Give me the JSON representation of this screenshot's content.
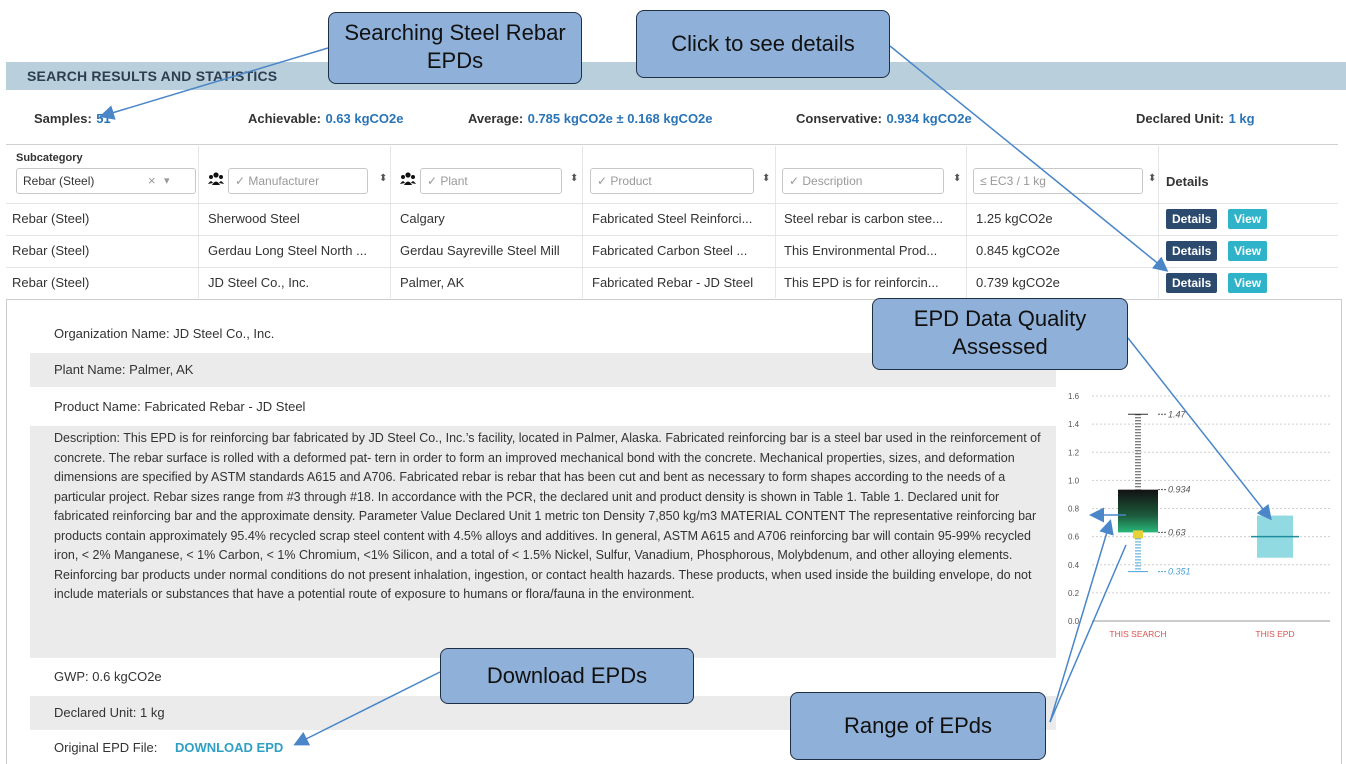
{
  "header": {
    "title": "SEARCH RESULTS AND STATISTICS"
  },
  "stats": {
    "samples_label": "Samples:",
    "samples_value": "51",
    "achievable_label": "Achievable:",
    "achievable_value": "0.63 kgCO2e",
    "average_label": "Average:",
    "average_value": "0.785 kgCO2e ± 0.168 kgCO2e",
    "conservative_label": "Conservative:",
    "conservative_value": "0.934 kgCO2e",
    "declared_label": "Declared Unit:",
    "declared_value": "1 kg"
  },
  "table": {
    "subcategory_header": "Subcategory",
    "subcategory_value": "Rebar (Steel)",
    "clear_glyph": "×",
    "caret_glyph": "▾",
    "sort_glyph": "⬍",
    "filters": {
      "manufacturer": "✓ Manufacturer",
      "plant": "✓ Plant",
      "product": "✓ Product",
      "description": "✓ Description",
      "ec3": "≤ EC3 / 1 kg"
    },
    "details_header": "Details",
    "rows": [
      {
        "subcategory": "Rebar (Steel)",
        "manufacturer": "Sherwood Steel",
        "plant": "Calgary",
        "product": "Fabricated Steel Reinforci...",
        "description": "Steel rebar is carbon stee...",
        "gwp": "1.25 kgCO2e",
        "details_btn": "Details",
        "view_btn": "View"
      },
      {
        "subcategory": "Rebar (Steel)",
        "manufacturer": "Gerdau Long Steel North ...",
        "plant": "Gerdau Sayreville Steel Mill",
        "product": "Fabricated Carbon Steel ...",
        "description": "This Environmental Prod...",
        "gwp": "0.845 kgCO2e",
        "details_btn": "Details",
        "view_btn": "View"
      },
      {
        "subcategory": "Rebar (Steel)",
        "manufacturer": "JD Steel Co., Inc.",
        "plant": "Palmer, AK",
        "product": "Fabricated Rebar - JD Steel",
        "description": "This EPD is for reinforcin...",
        "gwp": "0.739 kgCO2e",
        "details_btn": "Details",
        "view_btn": "View"
      }
    ]
  },
  "detail": {
    "organization": "Organization Name: JD Steel Co., Inc.",
    "plant": "Plant Name: Palmer, AK",
    "product": "Product Name: Fabricated Rebar - JD Steel",
    "description": "Description: This EPD is for reinforcing bar fabricated by JD Steel Co., Inc.’s facility, located in Palmer, Alaska. Fabricated reinforcing bar is a steel bar used in the reinforcement of concrete. The rebar surface is rolled with a deformed pat- tern in order to form an improved mechanical bond with the concrete. Mechanical properties, sizes, and deformation dimensions are specified by ASTM standards A615 and A706. Fabricated rebar is rebar that has been cut and bent as necessary to form shapes according to the needs of a particular project. Rebar sizes range from #3 through #18. In accordance with the PCR, the declared unit and product density is shown in Table 1. Table 1. Declared unit for fabricated reinforcing bar and the approximate density. Parameter Value Declared Unit 1 metric ton Density 7,850 kg/m3 MATERIAL CONTENT The representative reinforcing bar products contain approximately 95.4% recycled scrap steel content with 4.5% alloys and additives. In general, ASTM A615 and A706 reinforcing bar will contain 95-99% recycled iron, < 2% Manganese, < 1% Carbon, < 1% Chromium, <1% Silicon, and a total of < 1.5% Nickel, Sulfur, Vanadium, Phosphorous, Molybdenum, and other alloying elements. Reinforcing bar products under normal conditions do not present inhalation, ingestion, or contact health hazards. These products, when used inside the building envelope, do not include materials or substances that have a potential route of exposure to humans or flora/fauna in the environment.",
    "gwp": "GWP: 0.6 kgCO2e",
    "declared_unit": "Declared Unit: 1 kg",
    "original_file_label": "Original EPD File:",
    "download_link": "DOWNLOAD EPD"
  },
  "callouts": {
    "searching": "Searching Steel Rebar EPDs",
    "click_details": "Click to see details",
    "quality": "EPD Data Quality Assessed",
    "download": "Download EPDs",
    "range": "Range of EPds"
  },
  "chart_data": {
    "type": "box",
    "y_ticks": [
      "0.0",
      "0.2",
      "0.4",
      "0.6",
      "0.8",
      "1.0",
      "1.2",
      "1.4",
      "1.6"
    ],
    "ylim": [
      0,
      1.6
    ],
    "categories": [
      "THIS SEARCH",
      "THIS EPD"
    ],
    "this_search": {
      "min": 0.351,
      "achievable": 0.63,
      "conservative": 0.934,
      "max": 1.47
    },
    "this_epd": {
      "value": 0.6
    },
    "labels": [
      "1.47",
      "0.934",
      "0.63",
      "0.351"
    ]
  },
  "colors": {
    "accent": "#2a74b6",
    "details_btn": "#2c4a6e",
    "view_btn": "#2fb3c9",
    "callout": "#8fb0d8",
    "chart_category": "#d9534f"
  }
}
